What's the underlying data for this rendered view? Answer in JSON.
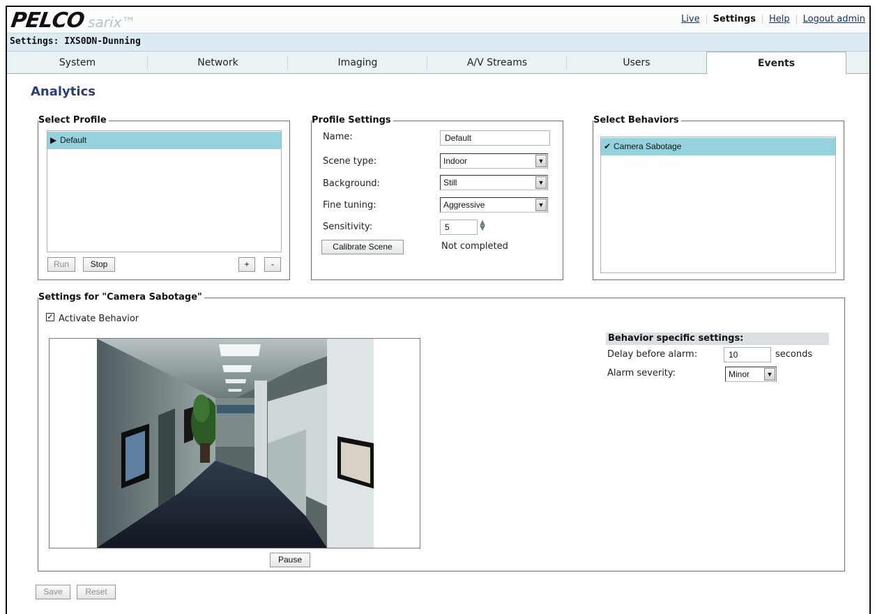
{
  "brand": {
    "name": "PELCO",
    "product": "sarix™"
  },
  "topnav": [
    {
      "label": "Live",
      "active": false
    },
    {
      "label": "Settings",
      "active": true
    },
    {
      "label": "Help",
      "active": false
    },
    {
      "label": "Logout admin",
      "active": false
    }
  ],
  "settings_title": "Settings: IXS0DN-Dunning",
  "tabs": [
    {
      "label": "System",
      "active": false
    },
    {
      "label": "Network",
      "active": false
    },
    {
      "label": "Imaging",
      "active": false
    },
    {
      "label": "A/V Streams",
      "active": false
    },
    {
      "label": "Users",
      "active": false
    },
    {
      "label": "Events",
      "active": true
    }
  ],
  "page_title": "Analytics",
  "select_profile": {
    "legend": "Select Profile",
    "items": [
      {
        "label": "Default",
        "selected": true,
        "icon": "play-arrow-icon"
      }
    ],
    "run_label": "Run",
    "stop_label": "Stop",
    "add_label": "+",
    "remove_label": "-"
  },
  "profile_settings": {
    "legend": "Profile Settings",
    "name_label": "Name:",
    "name_value": "Default",
    "scene_type_label": "Scene type:",
    "scene_type_value": "Indoor",
    "background_label": "Background:",
    "background_value": "Still",
    "fine_tuning_label": "Fine tuning:",
    "fine_tuning_value": "Aggressive",
    "sensitivity_label": "Sensitivity:",
    "sensitivity_value": "5",
    "calibrate_label": "Calibrate Scene",
    "calibrate_status": "Not completed"
  },
  "select_behaviors": {
    "legend": "Select Behaviors",
    "items": [
      {
        "label": "Camera Sabotage",
        "checked": true,
        "icon": "checkmark-icon"
      }
    ]
  },
  "behavior_settings": {
    "legend": "Settings for \"Camera Sabotage\"",
    "activate_label": "Activate Behavior",
    "activate_checked": true,
    "pause_label": "Pause",
    "specific_header": "Behavior specific settings:",
    "delay_label": "Delay before alarm:",
    "delay_value": "10",
    "delay_unit": "seconds",
    "severity_label": "Alarm severity:",
    "severity_value": "Minor"
  },
  "footer": {
    "save_label": "Save",
    "reset_label": "Reset"
  },
  "colors": {
    "selection": "#94d3de",
    "title": "#2a3f7a",
    "settings_bar": "#dcebf1"
  }
}
